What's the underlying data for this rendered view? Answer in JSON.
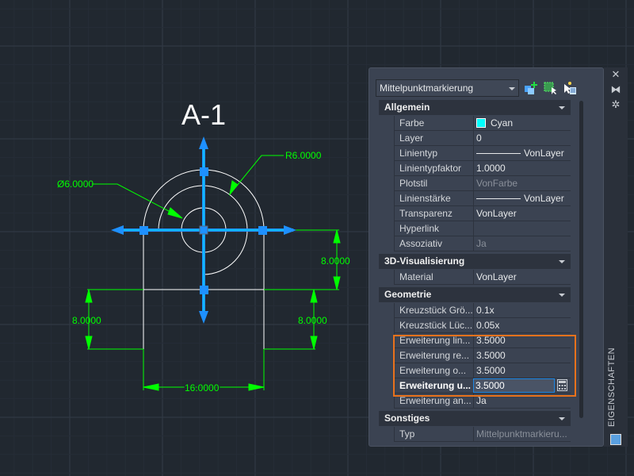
{
  "drawing": {
    "label": "A-1",
    "dim_diameter": "Ø6.0000",
    "dim_radius": "R6.0000",
    "dim_right_height": "8.0000",
    "dim_left_height": "8.0000",
    "dim_right_lower": "8.0000",
    "dim_width": "16.0000",
    "colors": {
      "background": "#212830",
      "geometry": "#ffffff",
      "dimension": "#00ff00",
      "centermark": "#1e90ff"
    }
  },
  "panel": {
    "title": "EIGENSCHAFTEN",
    "selector": "Mittelpunktmarkierung",
    "icons": [
      "add-selection-icon",
      "quick-select-icon",
      "select-objects-icon",
      "close-icon",
      "auto-hide-icon",
      "settings-icon",
      "properties-icon"
    ],
    "sections": [
      {
        "title": "Allgemein",
        "rows": [
          {
            "key": "Farbe",
            "value": "Cyan"
          },
          {
            "key": "Layer",
            "value": "0"
          },
          {
            "key": "Linientyp",
            "value": "VonLayer"
          },
          {
            "key": "Linientypfaktor",
            "value": "1.0000"
          },
          {
            "key": "Plotstil",
            "value": "VonFarbe"
          },
          {
            "key": "Linienstärke",
            "value": "VonLayer"
          },
          {
            "key": "Transparenz",
            "value": "VonLayer"
          },
          {
            "key": "Hyperlink",
            "value": ""
          },
          {
            "key": "Assoziativ",
            "value": "Ja"
          }
        ]
      },
      {
        "title": "3D-Visualisierung",
        "rows": [
          {
            "key": "Material",
            "value": "VonLayer"
          }
        ]
      },
      {
        "title": "Geometrie",
        "rows": [
          {
            "key": "Kreuzstück Grö...",
            "value": "0.1x"
          },
          {
            "key": "Kreuzstück Lüc...",
            "value": "0.05x"
          },
          {
            "key": "Erweiterung lin...",
            "value": "3.5000"
          },
          {
            "key": "Erweiterung re...",
            "value": "3.5000"
          },
          {
            "key": "Erweiterung o...",
            "value": "3.5000"
          },
          {
            "key": "Erweiterung u...",
            "value": "3.5000"
          },
          {
            "key": "Erweiterung an...",
            "value": "Ja"
          }
        ]
      },
      {
        "title": "Sonstiges",
        "rows": [
          {
            "key": "Typ",
            "value": "Mittelpunktmarkieru..."
          }
        ]
      }
    ],
    "highlight_color": "#e8721c"
  }
}
